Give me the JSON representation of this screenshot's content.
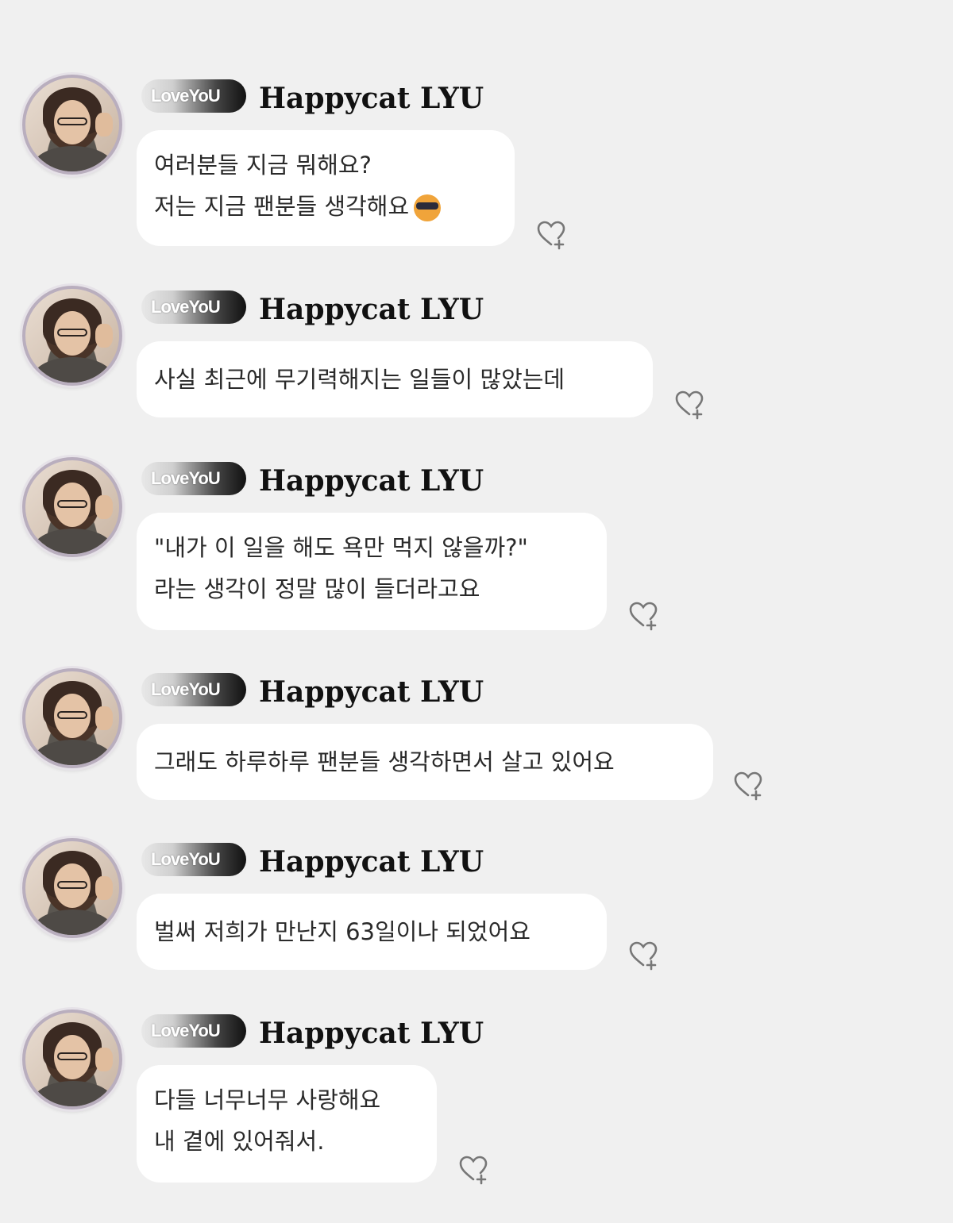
{
  "user": {
    "badge": "LoveYoU",
    "name": "Happycat LYU"
  },
  "messages": [
    {
      "lines": [
        "여러분들 지금 뭐해요?",
        "저는 지금 팬분들 생각해요"
      ],
      "emoji": "sunglasses-face-icon"
    },
    {
      "lines": [
        "사실 최근에 무기력해지는 일들이 많았는데"
      ]
    },
    {
      "lines": [
        "\"내가 이 일을 해도 욕만 먹지 않을까?\"",
        "라는 생각이 정말 많이 들더라고요"
      ]
    },
    {
      "lines": [
        "그래도 하루하루 팬분들 생각하면서 살고 있어요"
      ]
    },
    {
      "lines": [
        "벌써 저희가 만난지 63일이나 되었어요"
      ]
    },
    {
      "lines": [
        "다들 너무너무 사랑해요",
        "내 곁에 있어줘서."
      ]
    }
  ],
  "colors": {
    "background": "#f0f0f0",
    "bubble": "#ffffff",
    "name": "#111111"
  }
}
